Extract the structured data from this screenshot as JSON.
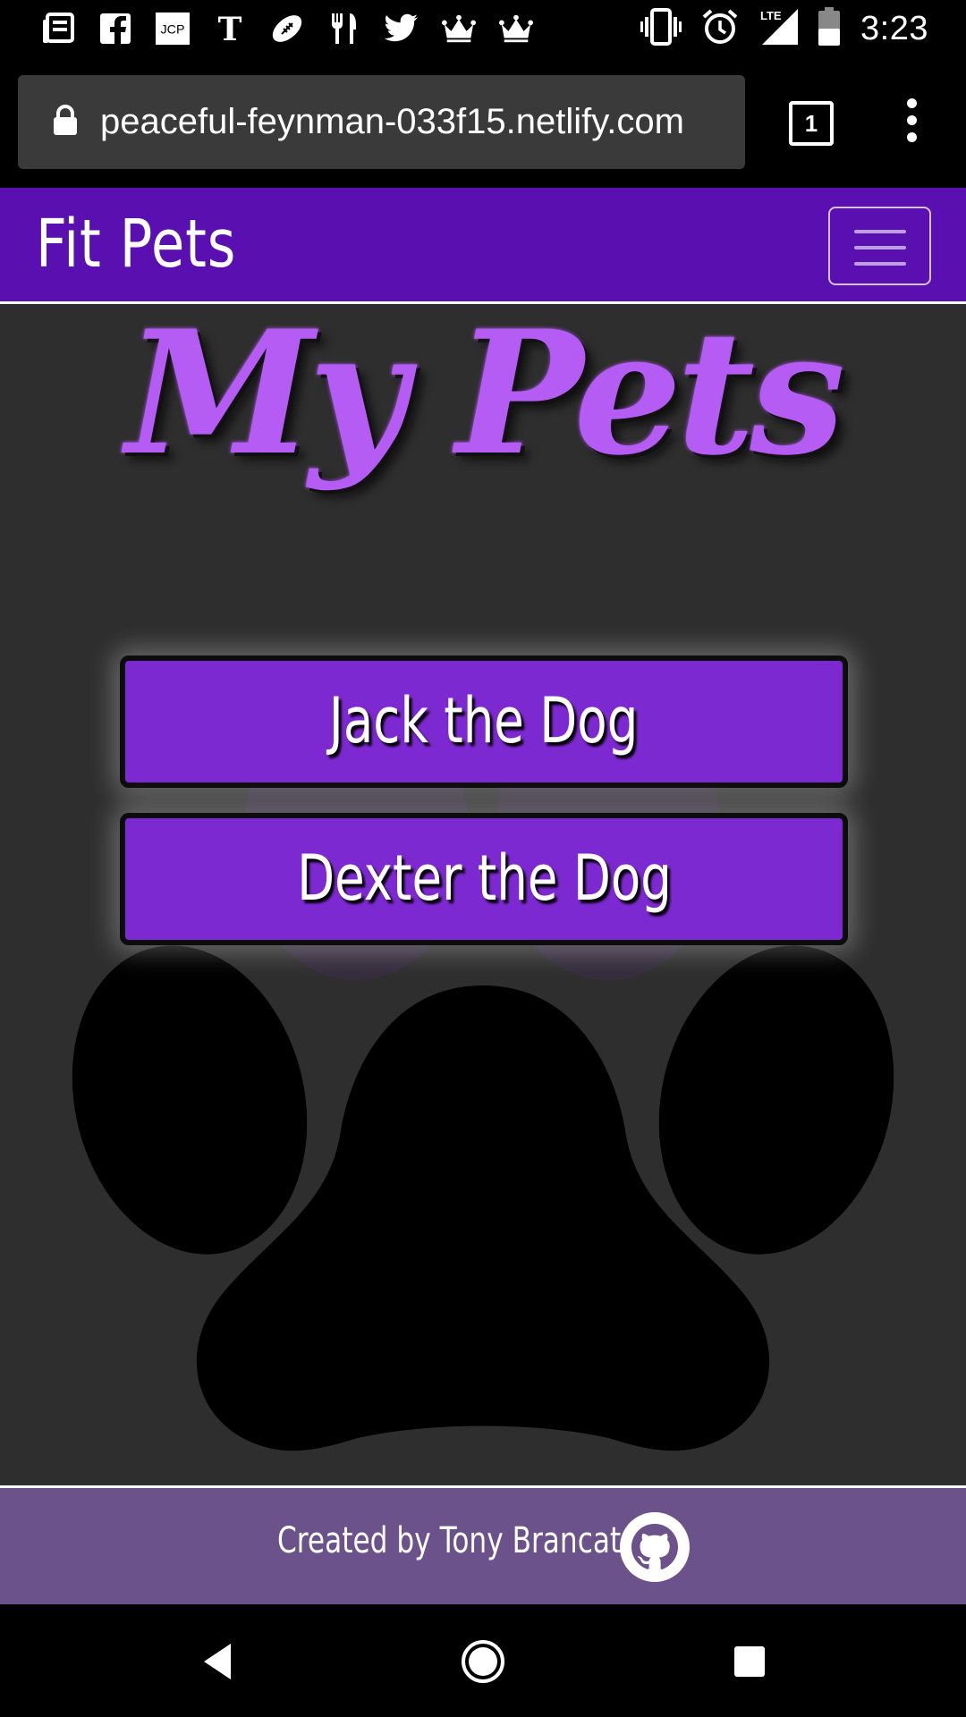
{
  "status_bar": {
    "time": "3:23",
    "left_icons": [
      "news-icon",
      "facebook-icon",
      "jcp-icon",
      "nytimes-icon",
      "football-icon",
      "restaurant-icon",
      "twitter-icon",
      "crown-icon",
      "crown-icon"
    ],
    "jcp_label": "JCP",
    "right_icons": [
      "vibrate-icon",
      "alarm-icon",
      "lte-signal-icon",
      "battery-icon"
    ],
    "network_label": "LTE"
  },
  "browser": {
    "url": "peaceful-feynman-033f15.netlify.com",
    "tab_count": "1"
  },
  "navbar": {
    "brand": "Fit Pets"
  },
  "main": {
    "heading": "My Pets",
    "pets": [
      {
        "label": "Jack the Dog"
      },
      {
        "label": "Dexter the Dog"
      }
    ]
  },
  "footer": {
    "credit": "Created by Tony Brancato"
  },
  "colors": {
    "navbar": "#5a0fb0",
    "heading": "#b45cf4",
    "button": "#7d29d1",
    "footer": "#6b528b",
    "page_background": "#2e2e2e"
  }
}
